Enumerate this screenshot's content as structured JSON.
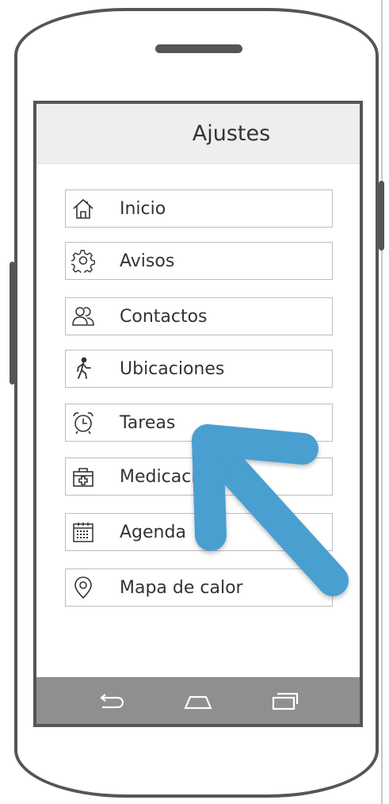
{
  "header": {
    "title": "Ajustes"
  },
  "menu": {
    "items": [
      {
        "label": "Inicio",
        "icon": "home-icon"
      },
      {
        "label": "Avisos",
        "icon": "gear-icon"
      },
      {
        "label": "Contactos",
        "icon": "contacts-icon"
      },
      {
        "label": "Ubicaciones",
        "icon": "walking-person-icon"
      },
      {
        "label": "Tareas",
        "icon": "alarm-clock-icon"
      },
      {
        "label": "Medicación",
        "icon": "first-aid-kit-icon"
      },
      {
        "label": "Agenda",
        "icon": "calendar-icon"
      },
      {
        "label": "Mapa de calor",
        "icon": "location-pin-icon"
      }
    ]
  },
  "navbar": {
    "icons": [
      "back-icon",
      "home-icon",
      "recent-apps-icon"
    ]
  },
  "colors": {
    "arrow": "#4a9fd0",
    "navbar": "#8f8f8f",
    "header": "#eeeeee"
  }
}
